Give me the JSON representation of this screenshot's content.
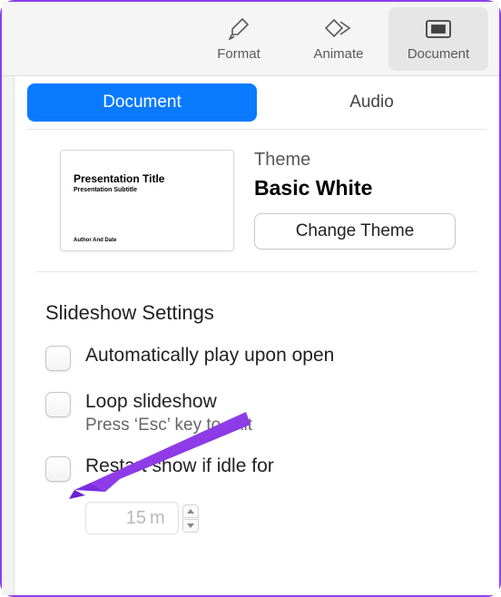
{
  "toolbar": {
    "format": "Format",
    "animate": "Animate",
    "document": "Document"
  },
  "tabs": {
    "document": "Document",
    "audio": "Audio"
  },
  "theme": {
    "label": "Theme",
    "name": "Basic White",
    "change_btn": "Change Theme",
    "thumb": {
      "title": "Presentation Title",
      "subtitle": "Presentation Subtitle",
      "author": "Author And Date"
    }
  },
  "slideshow": {
    "title": "Slideshow Settings",
    "auto_play": "Automatically play upon open",
    "loop": "Loop slideshow",
    "loop_sub": "Press ‘Esc’ key to exit",
    "restart": "Restart show if idle for",
    "idle_value": "15",
    "idle_unit": "m"
  }
}
